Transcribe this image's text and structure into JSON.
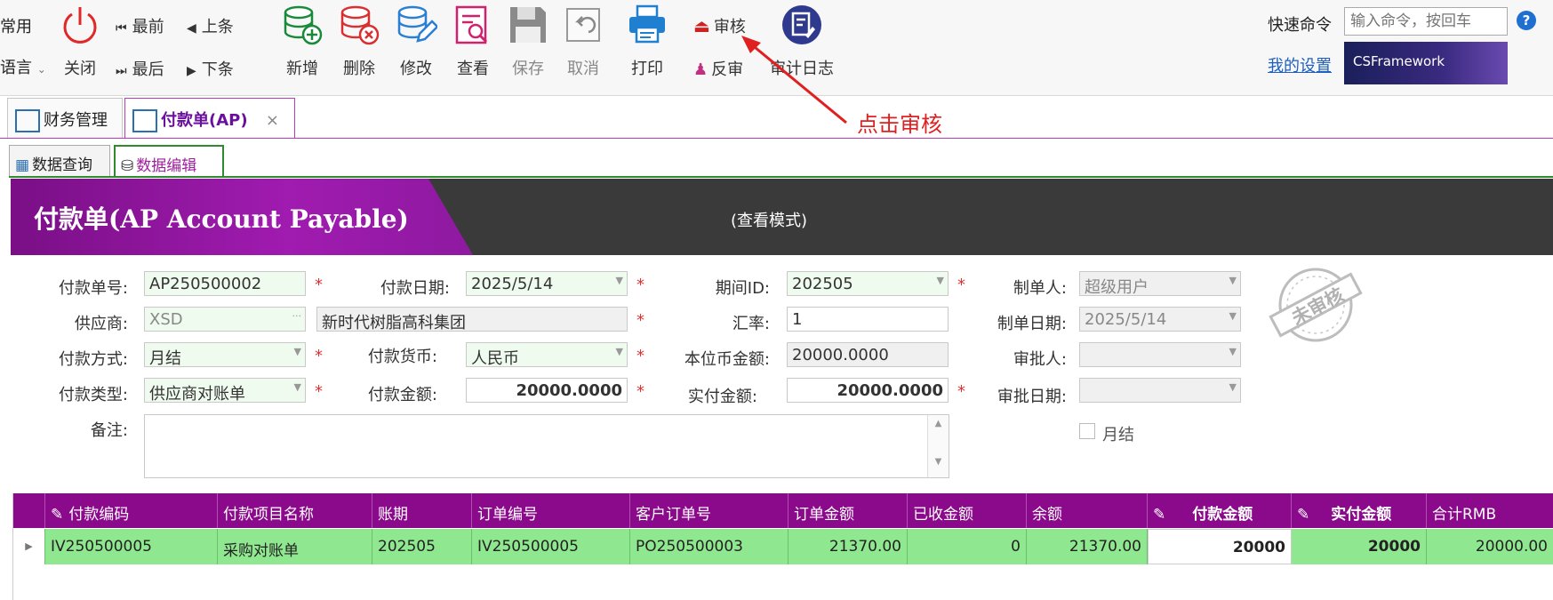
{
  "ribbon": {
    "left_labels": [
      "常用",
      "语言"
    ],
    "close": "关闭",
    "first": "最前",
    "prev": "上条",
    "last": "最后",
    "next": "下条",
    "add": "新增",
    "delete": "删除",
    "modify": "修改",
    "view": "查看",
    "save": "保存",
    "cancel": "取消",
    "print": "打印",
    "approve": "审核",
    "unapprove": "反审",
    "audit_log": "审计日志",
    "quick_cmd_label": "快速命令",
    "quick_cmd_placeholder": "输入命令，按回车",
    "my_settings": "我的设置",
    "brand": "CSFramework"
  },
  "annotation": {
    "text": "点击审核",
    "color": "#e02020"
  },
  "tabs": [
    {
      "label": "财务管理"
    },
    {
      "label": "付款单(AP)"
    }
  ],
  "subtabs": [
    {
      "label": "数据查询"
    },
    {
      "label": "数据编辑"
    }
  ],
  "banner": {
    "title": "付款单(AP Account Payable)",
    "mode": "(查看模式)"
  },
  "form": {
    "pay_no_label": "付款单号:",
    "pay_no": "AP250500002",
    "pay_date_label": "付款日期:",
    "pay_date": "2025/5/14",
    "period_label": "期间ID:",
    "period": "202505",
    "creator_label": "制单人:",
    "creator": "超级用户",
    "supplier_label": "供应商:",
    "supplier_code": "XSD",
    "supplier_name": "新时代树脂高科集团",
    "rate_label": "汇率:",
    "rate": "1",
    "create_date_label": "制单日期:",
    "create_date": "2025/5/14",
    "pay_method_label": "付款方式:",
    "pay_method": "月结",
    "currency_label": "付款货币:",
    "currency": "人民币",
    "local_amount_label": "本位币金额:",
    "local_amount": "20000.0000",
    "approver_label": "审批人:",
    "approver": "",
    "pay_type_label": "付款类型:",
    "pay_type": "供应商对账单",
    "pay_amount_label": "付款金额:",
    "pay_amount": "20000.0000",
    "actual_amount_label": "实付金额:",
    "actual_amount": "20000.0000",
    "approve_date_label": "审批日期:",
    "approve_date": "",
    "remark_label": "备注:",
    "monthly_label": "月结",
    "stamp_text": "未审核"
  },
  "grid": {
    "columns": [
      "付款编码",
      "付款项目名称",
      "账期",
      "订单编号",
      "客户订单号",
      "订单金额",
      "已收金额",
      "余额",
      "付款金额",
      "实付金额",
      "合计RMB"
    ],
    "rows": [
      [
        "IV250500005",
        "采购对账单",
        "202505",
        "IV250500005",
        "PO250500003",
        "21370.00",
        "0",
        "21370.00",
        "20000",
        "20000",
        "20000.00"
      ]
    ]
  },
  "colors": {
    "accent": "#8b0a8b",
    "row_green": "#8fe88f",
    "required": "#e03030"
  }
}
